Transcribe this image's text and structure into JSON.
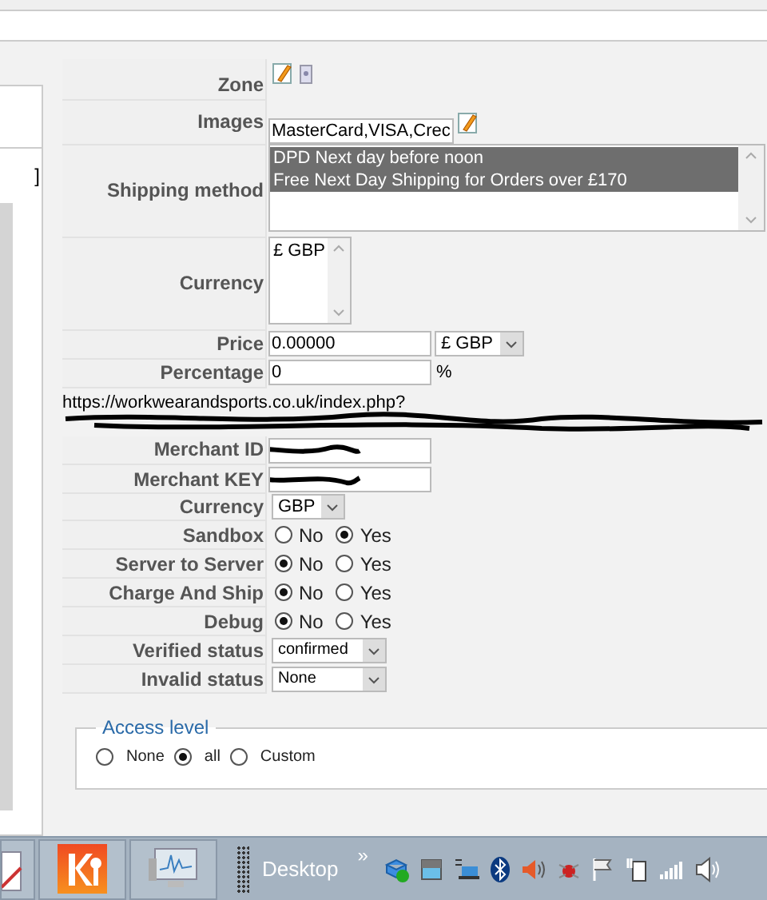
{
  "left_panel": {
    "bracket": "]"
  },
  "form": {
    "zone": {
      "label": "Zone"
    },
    "images": {
      "label": "Images",
      "value": "MasterCard,VISA,Crec"
    },
    "shipping": {
      "label": "Shipping method",
      "options": [
        {
          "text": "DPD Next day before noon",
          "selected": true
        },
        {
          "text": "Free Next Day Shipping for Orders over £170",
          "selected": true
        }
      ]
    },
    "currency_list": {
      "label": "Currency",
      "options": [
        {
          "text": "£ GBP",
          "selected": false
        }
      ]
    },
    "price": {
      "label": "Price",
      "value": "0.00000",
      "currency": "£ GBP"
    },
    "percentage": {
      "label": "Percentage",
      "value": "0",
      "unit": "%"
    },
    "url": {
      "line_1": "https://workwearandsports.co.uk/index.php?"
    },
    "merchant_id": {
      "label": "Merchant ID"
    },
    "merchant_key": {
      "label": "Merchant KEY"
    },
    "currency": {
      "label": "Currency",
      "value": "GBP"
    },
    "radios": [
      {
        "label": "Sandbox",
        "options": [
          {
            "text": "No",
            "selected": false
          },
          {
            "text": "Yes",
            "selected": true
          }
        ]
      },
      {
        "label": "Server to Server",
        "options": [
          {
            "text": "No",
            "selected": true
          },
          {
            "text": "Yes",
            "selected": false
          }
        ]
      },
      {
        "label": "Charge And Ship",
        "options": [
          {
            "text": "No",
            "selected": true
          },
          {
            "text": "Yes",
            "selected": false
          }
        ]
      },
      {
        "label": "Debug",
        "options": [
          {
            "text": "No",
            "selected": true
          },
          {
            "text": "Yes",
            "selected": false
          }
        ]
      }
    ],
    "verified_status": {
      "label": "Verified status",
      "value": "confirmed"
    },
    "invalid_status": {
      "label": "Invalid status",
      "value": "None"
    }
  },
  "access_level": {
    "legend": "Access level",
    "options": [
      {
        "text": "None",
        "selected": false
      },
      {
        "text": "all",
        "selected": true
      },
      {
        "text": "Custom",
        "selected": false
      }
    ]
  },
  "taskbar": {
    "toolbar_label": "Desktop",
    "chevron": "»"
  }
}
